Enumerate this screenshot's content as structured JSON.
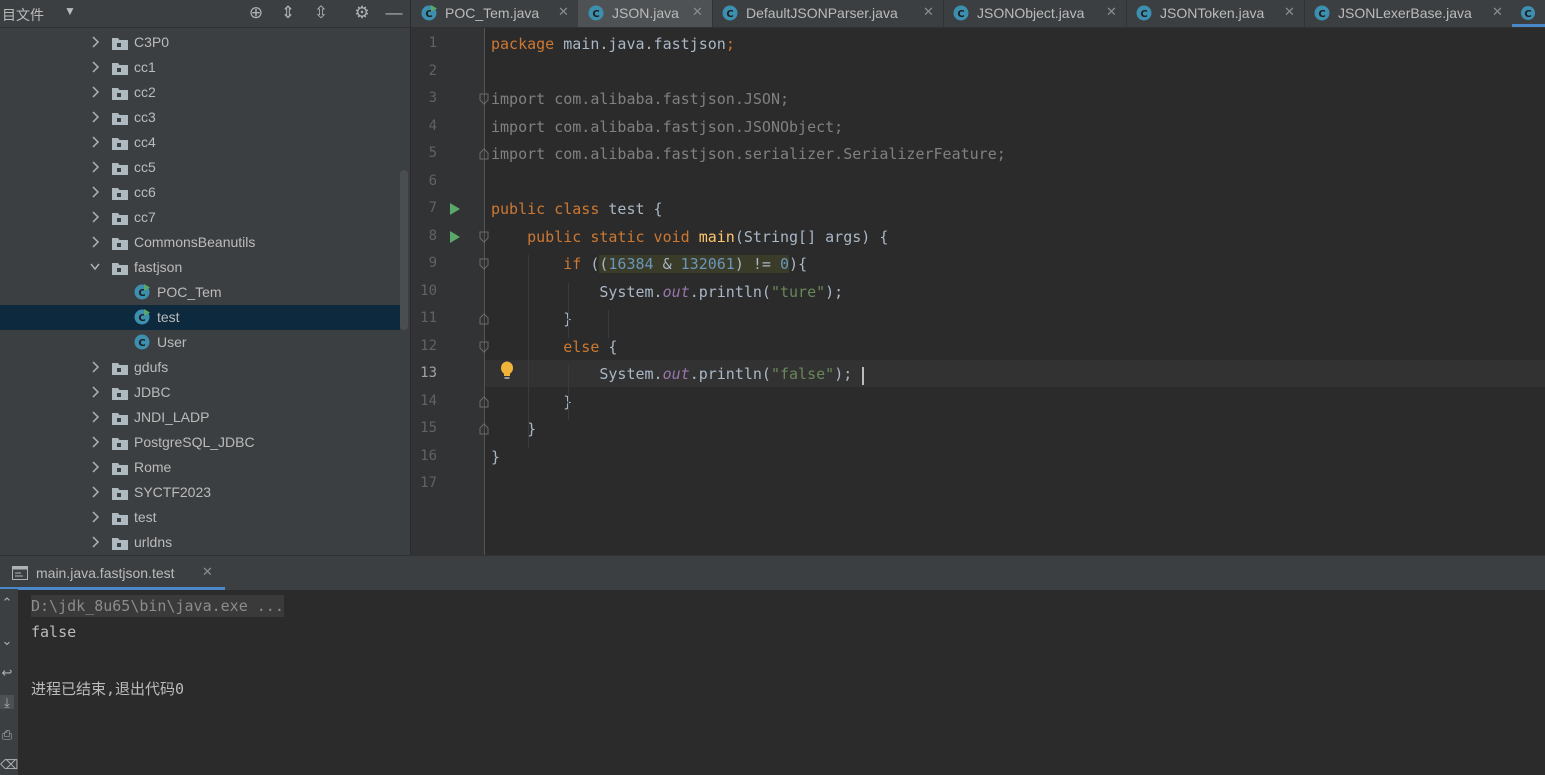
{
  "project": {
    "title": "目文件",
    "items": [
      {
        "label": "C3P0",
        "kind": "folder",
        "expanded": false,
        "depth": 0
      },
      {
        "label": "cc1",
        "kind": "folder",
        "expanded": false,
        "depth": 0
      },
      {
        "label": "cc2",
        "kind": "folder",
        "expanded": false,
        "depth": 0
      },
      {
        "label": "cc3",
        "kind": "folder",
        "expanded": false,
        "depth": 0
      },
      {
        "label": "cc4",
        "kind": "folder",
        "expanded": false,
        "depth": 0
      },
      {
        "label": "cc5",
        "kind": "folder",
        "expanded": false,
        "depth": 0
      },
      {
        "label": "cc6",
        "kind": "folder",
        "expanded": false,
        "depth": 0
      },
      {
        "label": "cc7",
        "kind": "folder",
        "expanded": false,
        "depth": 0
      },
      {
        "label": "CommonsBeanutils",
        "kind": "folder",
        "expanded": false,
        "depth": 0
      },
      {
        "label": "fastjson",
        "kind": "folder",
        "expanded": true,
        "depth": 0
      },
      {
        "label": "POC_Tem",
        "kind": "class-main",
        "depth": 1
      },
      {
        "label": "test",
        "kind": "class-main",
        "depth": 1,
        "selected": true
      },
      {
        "label": "User",
        "kind": "class",
        "depth": 1
      },
      {
        "label": "gdufs",
        "kind": "folder",
        "expanded": false,
        "depth": 0
      },
      {
        "label": "JDBC",
        "kind": "folder",
        "expanded": false,
        "depth": 0
      },
      {
        "label": "JNDI_LADP",
        "kind": "folder",
        "expanded": false,
        "depth": 0
      },
      {
        "label": "PostgreSQL_JDBC",
        "kind": "folder",
        "expanded": false,
        "depth": 0
      },
      {
        "label": "Rome",
        "kind": "folder",
        "expanded": false,
        "depth": 0
      },
      {
        "label": "SYCTF2023",
        "kind": "folder",
        "expanded": false,
        "depth": 0
      },
      {
        "label": "test",
        "kind": "folder",
        "expanded": false,
        "depth": 0
      },
      {
        "label": "urldns",
        "kind": "folder",
        "expanded": false,
        "depth": 0
      }
    ]
  },
  "tabs": [
    {
      "label": "POC_Tem.java",
      "icon": "class-main-icon",
      "active": false
    },
    {
      "label": "JSON.java",
      "icon": "class-icon",
      "active": true
    },
    {
      "label": "DefaultJSONParser.java",
      "icon": "class-icon",
      "active": false
    },
    {
      "label": "JSONObject.java",
      "icon": "class-icon",
      "active": false
    },
    {
      "label": "JSONToken.java",
      "icon": "class-icon",
      "active": false
    },
    {
      "label": "JSONLexerBase.java",
      "icon": "class-icon",
      "active": false
    }
  ],
  "editor": {
    "current_line": 13,
    "lines": [
      {
        "n": "1",
        "tokens": [
          [
            "kw",
            "package "
          ],
          [
            "",
            "main.java.fastjson"
          ],
          [
            "kw",
            ";"
          ]
        ]
      },
      {
        "n": "2",
        "tokens": []
      },
      {
        "n": "3",
        "tokens": [
          [
            "gray",
            "import com.alibaba.fastjson.JSON;"
          ]
        ]
      },
      {
        "n": "4",
        "tokens": [
          [
            "gray",
            "import com.alibaba.fastjson.JSONObject;"
          ]
        ]
      },
      {
        "n": "5",
        "tokens": [
          [
            "gray",
            "import com.alibaba.fastjson.serializer.SerializerFeature;"
          ]
        ]
      },
      {
        "n": "6",
        "tokens": []
      },
      {
        "n": "7",
        "tokens": [
          [
            "kw",
            "public class "
          ],
          [
            "",
            "test {"
          ]
        ]
      },
      {
        "n": "8",
        "tokens": [
          [
            "",
            "    "
          ],
          [
            "kw",
            "public static void "
          ],
          [
            "fn",
            "main"
          ],
          [
            "",
            "(String[] args) {"
          ]
        ]
      },
      {
        "n": "9",
        "tokens": [
          [
            "",
            "        "
          ],
          [
            "kw",
            "if "
          ],
          [
            "",
            "("
          ],
          [
            "hl",
            "("
          ],
          [
            "num hl",
            "16384"
          ],
          [
            "hl",
            " & "
          ],
          [
            "num hl",
            "132061"
          ],
          [
            "hl",
            ") != "
          ],
          [
            "num hl",
            "0"
          ],
          [
            "",
            ")"
          ],
          [
            "",
            "{"
          ]
        ]
      },
      {
        "n": "10",
        "tokens": [
          [
            "",
            "            System."
          ],
          [
            "static",
            "out"
          ],
          [
            "",
            ".println("
          ],
          [
            "str",
            "\"ture\""
          ],
          [
            "",
            ");"
          ]
        ]
      },
      {
        "n": "11",
        "tokens": [
          [
            "",
            "        }"
          ]
        ]
      },
      {
        "n": "12",
        "tokens": [
          [
            "",
            "        "
          ],
          [
            "kw",
            "else "
          ],
          [
            "",
            "{"
          ]
        ]
      },
      {
        "n": "13",
        "tokens": [
          [
            "",
            "            System."
          ],
          [
            "static",
            "out"
          ],
          [
            "",
            ".println("
          ],
          [
            "str",
            "\"false\""
          ],
          [
            "",
            ");"
          ]
        ]
      },
      {
        "n": "14",
        "tokens": [
          [
            "",
            "        }"
          ]
        ]
      },
      {
        "n": "15",
        "tokens": [
          [
            "",
            "    }"
          ]
        ]
      },
      {
        "n": "16",
        "tokens": [
          [
            "",
            "}"
          ]
        ]
      },
      {
        "n": "17",
        "tokens": []
      }
    ]
  },
  "run": {
    "tab_label": "main.java.fastjson.test",
    "console_command": "D:\\jdk_8u65\\bin\\java.exe ...",
    "console_output": "false",
    "console_exit": "进程已结束,退出代码0"
  }
}
